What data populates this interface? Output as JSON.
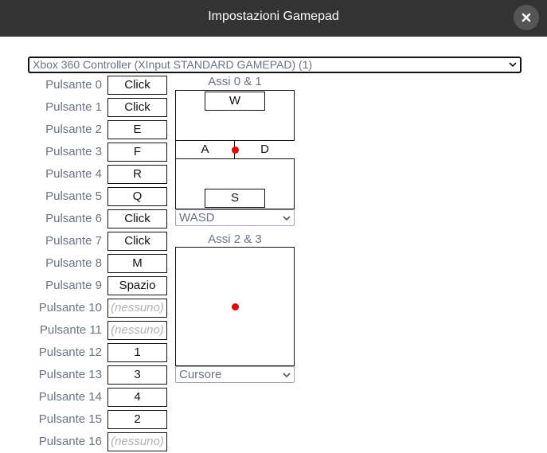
{
  "dialog": {
    "title": "Impostazioni Gamepad",
    "close_icon": "close-icon"
  },
  "controller_select": {
    "value": "Xbox 360 Controller (XInput STANDARD GAMEPAD) (1)"
  },
  "buttons": [
    {
      "label": "Pulsante 0",
      "value": "Click"
    },
    {
      "label": "Pulsante 1",
      "value": "Click"
    },
    {
      "label": "Pulsante 2",
      "value": "E"
    },
    {
      "label": "Pulsante 3",
      "value": "F"
    },
    {
      "label": "Pulsante 4",
      "value": "R"
    },
    {
      "label": "Pulsante 5",
      "value": "Q"
    },
    {
      "label": "Pulsante 6",
      "value": "Click"
    },
    {
      "label": "Pulsante 7",
      "value": "Click"
    },
    {
      "label": "Pulsante 8",
      "value": "M"
    },
    {
      "label": "Pulsante 9",
      "value": "Spazio"
    },
    {
      "label": "Pulsante 10",
      "value": "(nessuno)"
    },
    {
      "label": "Pulsante 11",
      "value": "(nessuno)"
    },
    {
      "label": "Pulsante 12",
      "value": "1"
    },
    {
      "label": "Pulsante 13",
      "value": "3"
    },
    {
      "label": "Pulsante 14",
      "value": "4"
    },
    {
      "label": "Pulsante 15",
      "value": "2"
    },
    {
      "label": "Pulsante 16",
      "value": "(nessuno)"
    }
  ],
  "axes_0_1": {
    "label": "Assi 0 & 1",
    "up": "W",
    "left": "A",
    "right": "D",
    "down": "S",
    "mapping": "WASD"
  },
  "axes_2_3": {
    "label": "Assi 2 & 3",
    "mapping": "Cursore"
  },
  "colors": {
    "titlebar": "#333333",
    "indicator": "#ee0000",
    "label_text": "#6b7280",
    "unassigned_text": "#b0b0b0"
  }
}
